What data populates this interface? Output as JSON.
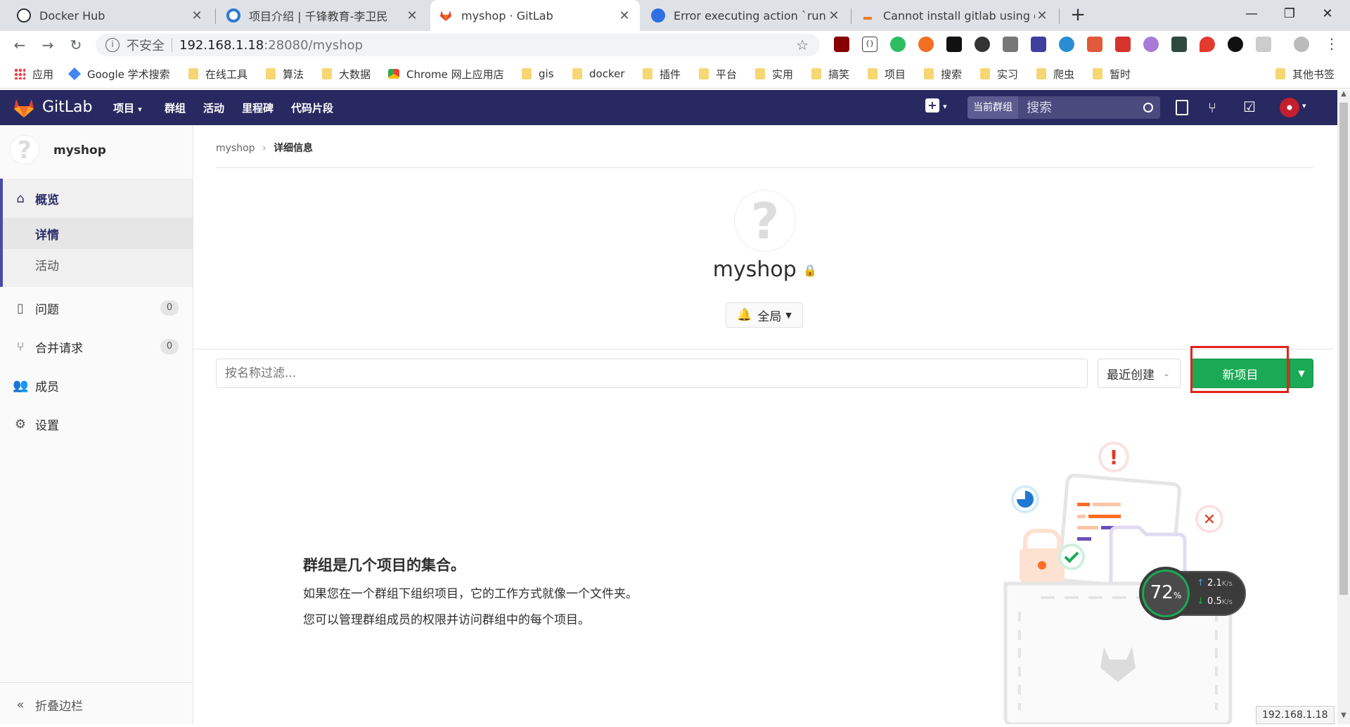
{
  "browser": {
    "tabs": [
      {
        "title": "Docker Hub",
        "icon": "docker-hub-icon",
        "active": false
      },
      {
        "title": "项目介绍 | 千锋教育-李卫民",
        "icon": "blog-icon",
        "active": false
      },
      {
        "title": "myshop · GitLab",
        "icon": "gitlab-icon",
        "active": true
      },
      {
        "title": "Error executing action `run` on",
        "icon": "baidu-icon",
        "active": false
      },
      {
        "title": "Cannot install gitlab using om",
        "icon": "stackoverflow-icon",
        "active": false
      }
    ],
    "new_tab": "+",
    "window_controls": {
      "minimize": "—",
      "restore": "❐",
      "close": "✕"
    },
    "address": {
      "security": "不安全",
      "host": "192.168.1.18",
      "path": ":28080/myshop"
    },
    "bookmarks": [
      {
        "label": "应用",
        "icon": "apps-icon"
      },
      {
        "label": "Google 学术搜索",
        "icon": "scholar-icon"
      },
      {
        "label": "在线工具",
        "icon": "folder-icon"
      },
      {
        "label": "算法",
        "icon": "folder-icon"
      },
      {
        "label": "大数据",
        "icon": "folder-icon"
      },
      {
        "label": "Chrome 网上应用店",
        "icon": "webstore-icon"
      },
      {
        "label": "gis",
        "icon": "folder-icon"
      },
      {
        "label": "docker",
        "icon": "folder-icon"
      },
      {
        "label": "插件",
        "icon": "folder-icon"
      },
      {
        "label": "平台",
        "icon": "folder-icon"
      },
      {
        "label": "实用",
        "icon": "folder-icon"
      },
      {
        "label": "搞笑",
        "icon": "folder-icon"
      },
      {
        "label": "项目",
        "icon": "folder-icon"
      },
      {
        "label": "搜索",
        "icon": "folder-icon"
      },
      {
        "label": "实习",
        "icon": "folder-icon"
      },
      {
        "label": "爬虫",
        "icon": "folder-icon"
      },
      {
        "label": "暂时",
        "icon": "folder-icon"
      }
    ],
    "other_bookmarks": "其他书签",
    "status_url": "192.168.1.18"
  },
  "gitlab_nav": {
    "brand": "GitLab",
    "links": [
      "项目",
      "群组",
      "活动",
      "里程碑",
      "代码片段"
    ],
    "search_scope": "当前群组",
    "search_placeholder": "搜索"
  },
  "sidebar": {
    "group_name": "myshop",
    "overview": "概览",
    "details": "详情",
    "activity": "活动",
    "issues": "问题",
    "issues_count": "0",
    "merge_requests": "合并请求",
    "merge_requests_count": "0",
    "members": "成员",
    "settings": "设置",
    "collapse": "折叠边栏"
  },
  "main": {
    "breadcrumb": [
      "myshop",
      "详细信息"
    ],
    "group_title": "myshop",
    "notification_label": "全局",
    "filter_placeholder": "按名称过滤...",
    "sort_label": "最近创建",
    "new_project": "新项目",
    "empty_title": "群组是几个项目的集合。",
    "empty_line1": "如果您在一个群组下组织项目，它的工作方式就像一个文件夹。",
    "empty_line2": "您可以管理群组成员的权限并访问群组中的每个项目。"
  },
  "net_monitor": {
    "percent": "72",
    "percent_unit": "%",
    "upload": "2.1",
    "download": "0.5",
    "unit": "K/s"
  },
  "colors": {
    "gitlab_nav": "#292961",
    "new_project_green": "#1aaa55",
    "highlight_red": "#e2231a"
  }
}
